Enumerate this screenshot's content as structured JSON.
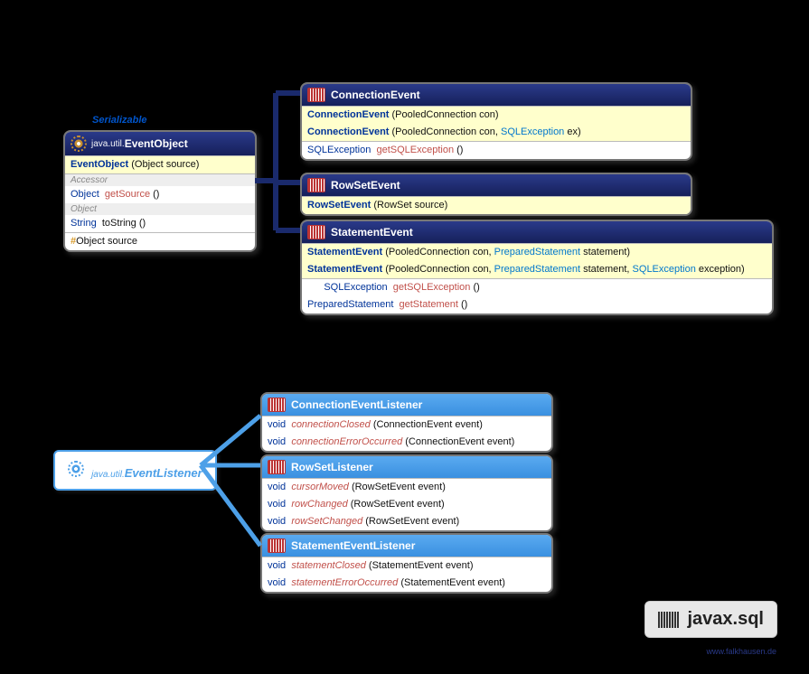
{
  "serializable_label": "Serializable",
  "eventobject": {
    "pkg": "java.util.",
    "name": "EventObject",
    "ctor": {
      "name": "EventObject",
      "params": "(Object source)"
    },
    "accessor_label": "Accessor",
    "m1": {
      "ret": "Object",
      "name": "getSource",
      "params": "()"
    },
    "grp2": "Object",
    "m2": {
      "ret": "String",
      "name": "toString",
      "params": "()"
    },
    "field": {
      "sym": "#",
      "type": "Object",
      "name": "source"
    }
  },
  "connectionevent": {
    "name": "ConnectionEvent",
    "c1": {
      "name": "ConnectionEvent",
      "params": "(PooledConnection con)"
    },
    "c2": {
      "name": "ConnectionEvent",
      "params_a": "(PooledConnection con, ",
      "params_b": "SQLException",
      "params_c": " ex)"
    },
    "m1": {
      "ret": "SQLException",
      "name": "getSQLException",
      "params": "()"
    }
  },
  "rowsetevent": {
    "name": "RowSetEvent",
    "c1": {
      "name": "RowSetEvent",
      "params": "(RowSet source)"
    }
  },
  "statementevent": {
    "name": "StatementEvent",
    "c1": {
      "name": "StatementEvent",
      "params_a": "(PooledConnection con, ",
      "params_b": "PreparedStatement",
      "params_c": " statement)"
    },
    "c2": {
      "name": "StatementEvent",
      "params_a": "(PooledConnection con, ",
      "params_b": "PreparedStatement",
      "params_c": " statement, ",
      "params_d": "SQLException",
      "params_e": " exception)"
    },
    "m1": {
      "ret": "SQLException",
      "name": "getSQLException",
      "params": "()"
    },
    "m2": {
      "ret": "PreparedStatement",
      "name": "getStatement",
      "params": "()"
    }
  },
  "eventlistener": {
    "pkg": "java.util.",
    "name": "EventListener"
  },
  "cel": {
    "name": "ConnectionEventListener",
    "m1": {
      "ret": "void",
      "name": "connectionClosed",
      "params": "(ConnectionEvent event)"
    },
    "m2": {
      "ret": "void",
      "name": "connectionErrorOccurred",
      "params": "(ConnectionEvent event)"
    }
  },
  "rsl": {
    "name": "RowSetListener",
    "m1": {
      "ret": "void",
      "name": "cursorMoved",
      "params": "(RowSetEvent event)"
    },
    "m2": {
      "ret": "void",
      "name": "rowChanged",
      "params": "(RowSetEvent event)"
    },
    "m3": {
      "ret": "void",
      "name": "rowSetChanged",
      "params": "(RowSetEvent event)"
    }
  },
  "sel": {
    "name": "StatementEventListener",
    "m1": {
      "ret": "void",
      "name": "statementClosed",
      "params": "(StatementEvent event)"
    },
    "m2": {
      "ret": "void",
      "name": "statementErrorOccurred",
      "params": "(StatementEvent event)"
    }
  },
  "footer": "javax.sql",
  "credit": "www.falkhausen.de"
}
